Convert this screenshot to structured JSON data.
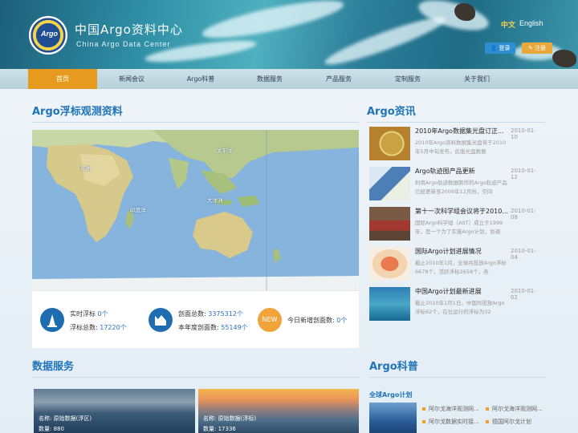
{
  "header": {
    "logo_text": "Argo",
    "title_cn": "中国Argo资料中心",
    "title_en": "China Argo Data Center",
    "lang_cn": "中文",
    "lang_en": "English",
    "login": "登录",
    "register": "注册"
  },
  "nav": [
    "首页",
    "新闻会议",
    "Argo科普",
    "数据服务",
    "产品服务",
    "定制服务",
    "关于我们"
  ],
  "map_section": {
    "title": "Argo浮标观测资料",
    "labels": {
      "africa": "非洲",
      "pacific": "太平洋",
      "indian": "印度洋",
      "australia": "大洋洲"
    }
  },
  "stats": {
    "realtime_label": "实时浮标",
    "realtime_value": "0个",
    "total_label": "浮标总数:",
    "total_value": "17220个",
    "profiles_label": "剖面总数:",
    "profiles_value": "3375312个",
    "year_label": "本年度剖面数:",
    "year_value": "55149个",
    "new_badge": "NEW",
    "today_label": "今日新增剖面数:",
    "today_value": "0个"
  },
  "news": {
    "title": "Argo资讯",
    "items": [
      {
        "title": "2010年Argo数据集光盘订正...",
        "date": "2010-01-10",
        "summary": "2010年Argo资料数据集光盘将于2010年5月中旬发布，此版光盘数据"
      },
      {
        "title": "Argo轨迹图产品更新",
        "date": "2010-01-12",
        "summary": "利用Argo轨迹数据制作的Argo轨迹产品已经更新至2009年12月份，空间"
      },
      {
        "title": "第十一次科学组会议将于2010...",
        "date": "2010-01-08",
        "summary": "国际Argo科学组（AST）成立于1999年，是一个为了实施Argo计划，协调"
      },
      {
        "title": "国际Argo计划进展情况",
        "date": "2010-01-04",
        "summary": "截止2010年1月，全球共投放Argo浮标6678个，活跃浮标2658个，各"
      },
      {
        "title": "中国Argo计划最新进展",
        "date": "2010-01-02",
        "summary": "截止2010年1月1日，中国共投放Argo浮标62个，在位运行的浮标为32"
      }
    ]
  },
  "data_service": {
    "title": "数据服务",
    "cards": [
      {
        "name_label": "名称:",
        "name": "原始数据(浮区)",
        "count_label": "数量:",
        "count": "880"
      },
      {
        "name_label": "名称:",
        "name": "原始数据(浮标)",
        "count_label": "数量:",
        "count": "17336"
      }
    ]
  },
  "science": {
    "title": "Argo科普",
    "subtitle": "全球Argo计划",
    "links": [
      "阿尔戈海洋观测网...",
      "阿尔戈海洋观测网...",
      "阿尔戈数据实时接...",
      "德国阿尔戈计划"
    ]
  }
}
